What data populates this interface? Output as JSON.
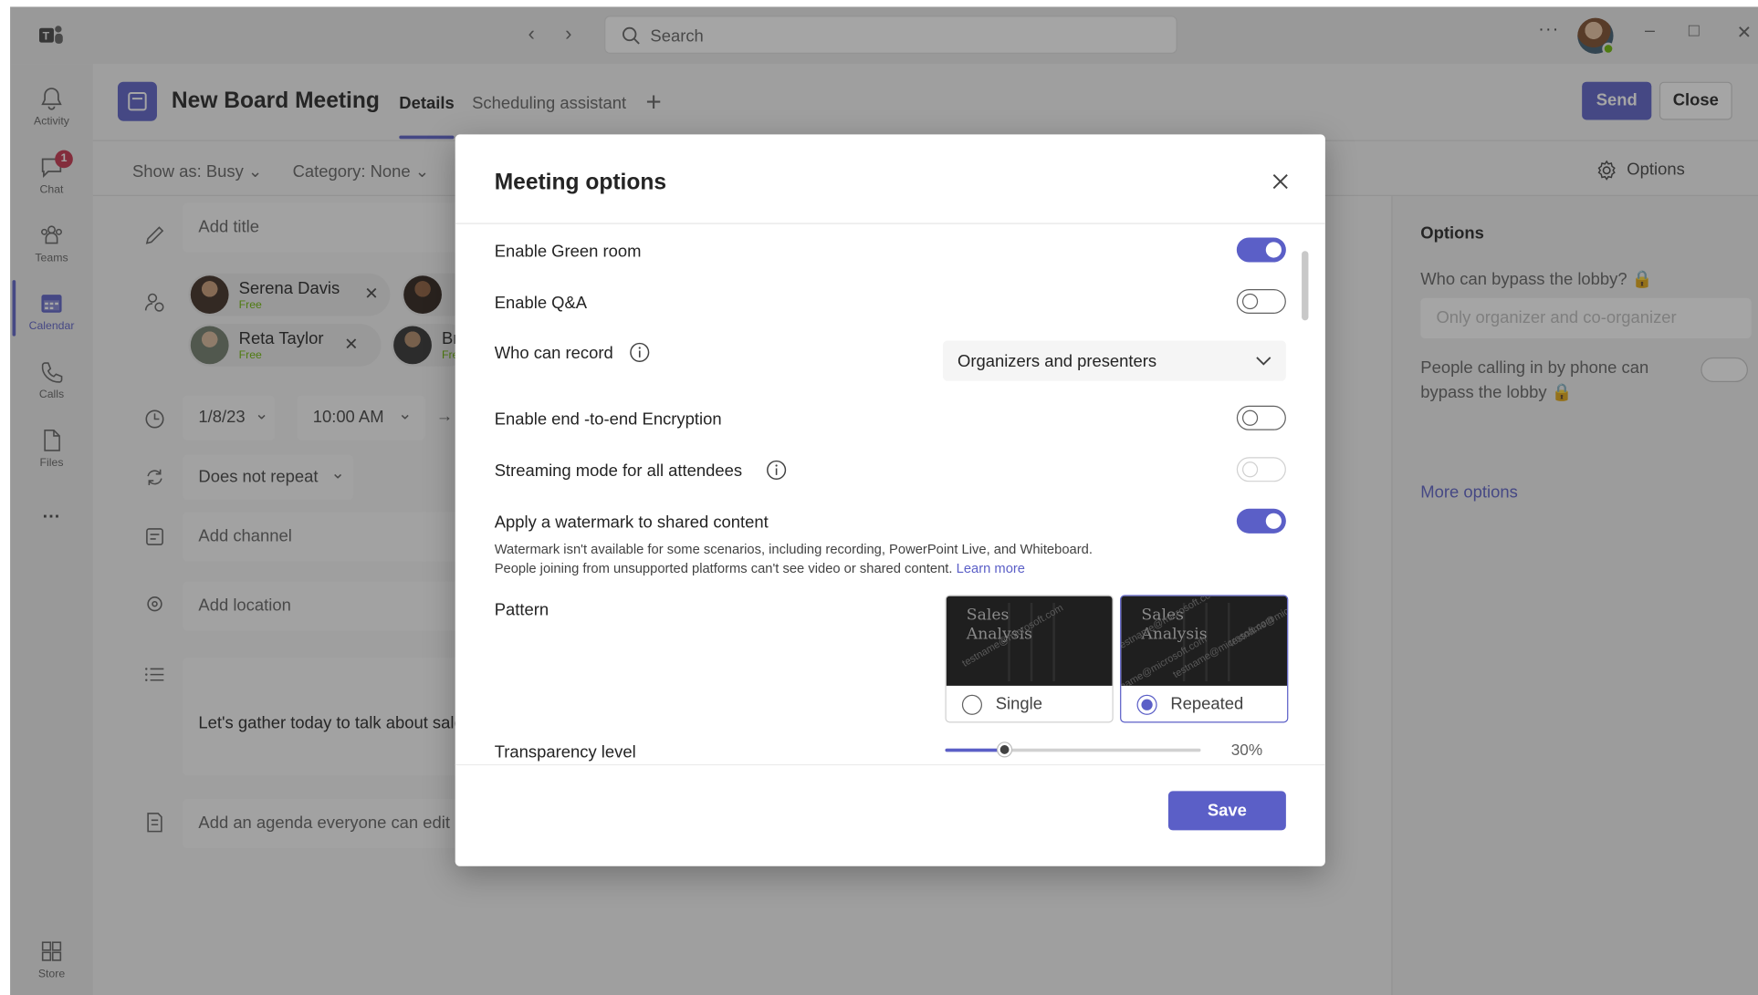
{
  "titlebar": {
    "search_placeholder": "Search",
    "more": "···",
    "back_icon": "chevron-left-icon",
    "forward_icon": "chevron-right-icon"
  },
  "rail": {
    "items": [
      {
        "label": "Activity",
        "icon": "bell-icon"
      },
      {
        "label": "Chat",
        "icon": "chat-icon",
        "badge": "1"
      },
      {
        "label": "Teams",
        "icon": "teams-icon"
      },
      {
        "label": "Calendar",
        "icon": "calendar-icon",
        "active": true
      },
      {
        "label": "Calls",
        "icon": "phone-icon"
      },
      {
        "label": "Files",
        "icon": "file-icon"
      },
      {
        "label": "Store",
        "icon": "store-icon"
      }
    ],
    "more": "···"
  },
  "meeting": {
    "title": "New Board Meeting",
    "tabs": [
      {
        "label": "Details",
        "active": true
      },
      {
        "label": "Scheduling assistant",
        "active": false
      }
    ],
    "send_label": "Send",
    "close_label": "Close",
    "show_as": "Show as: Busy",
    "category": "Category: None",
    "options_label": "Options",
    "add_title": "Add title",
    "attendees": [
      {
        "name": "Serena Davis",
        "status": "Free"
      },
      {
        "name": "Reta Taylor",
        "status": "Free"
      },
      {
        "name": "Br",
        "status": "Fre"
      }
    ],
    "date": "1/8/23",
    "time": "10:00 AM",
    "repeat": "Does not repeat",
    "add_channel": "Add channel",
    "add_location": "Add location",
    "editor_text": "Let's gather today to talk about sale",
    "add_agenda": "Add an agenda everyone can edit"
  },
  "right_panel": {
    "title": "Options",
    "bypass_label": "Who can bypass the lobby?",
    "bypass_value": "Only organizer and co-organizer",
    "phone_label": "People calling in by  phone can bypass the lobby",
    "more_options": "More options"
  },
  "modal": {
    "title": "Meeting options",
    "green_room": {
      "label": "Enable Green room",
      "on": true
    },
    "qa": {
      "label": "Enable Q&A",
      "on": false
    },
    "who_can_record": {
      "label": "Who can record",
      "value": "Organizers and presenters"
    },
    "e2e": {
      "label": "Enable end -to-end Encryption",
      "on": false
    },
    "streaming": {
      "label": "Streaming mode for all attendees",
      "on": false,
      "disabled": true
    },
    "watermark": {
      "label": "Apply a watermark to shared content",
      "on": true,
      "desc_line1": "Watermark isn't available for some scenarios, including recording, PowerPoint Live, and Whiteboard.",
      "desc_line2": "People joining from unsupported platforms can't see video or shared content.",
      "learn_more": "Learn more"
    },
    "pattern": {
      "label": "Pattern",
      "thumb_title_1": "Sales",
      "thumb_title_2": "Analysis",
      "thumb_watermark": "testname@microsoft.com",
      "options": [
        {
          "label": "Single",
          "checked": false
        },
        {
          "label": "Repeated",
          "checked": true
        }
      ]
    },
    "transparency": {
      "label": "Transparency level",
      "value_text": "30%",
      "value": 0.3
    },
    "save_label": "Save"
  },
  "colors": {
    "accent": "#5b5fc7",
    "badge": "#c4314b",
    "presence": "#6bb700"
  }
}
